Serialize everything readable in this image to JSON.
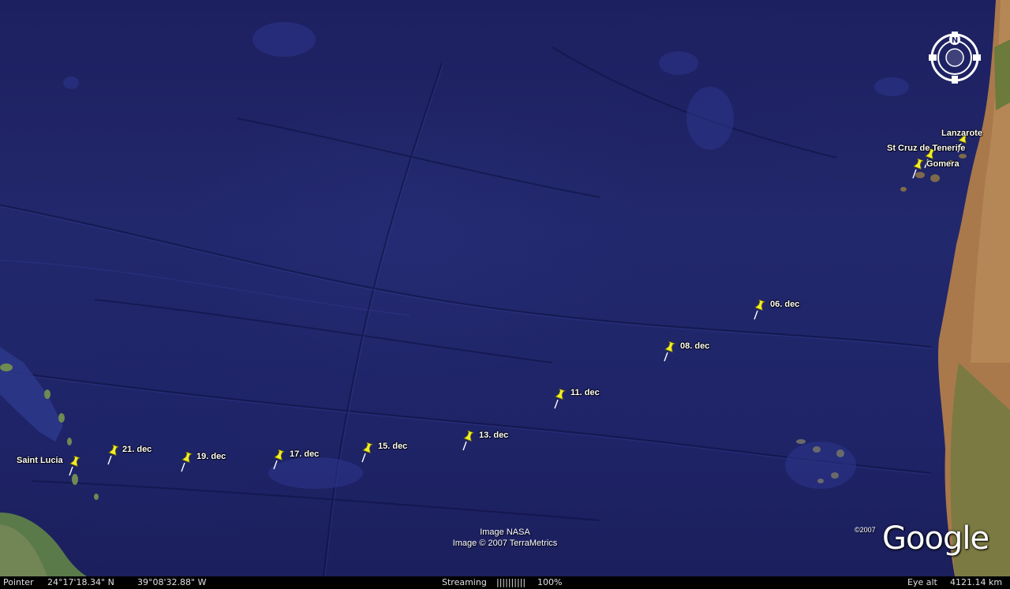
{
  "markers": [
    {
      "label": "Lanzarote"
    },
    {
      "label": "St Cruz de Tenerife"
    },
    {
      "label": "Gomera"
    },
    {
      "label": "06. dec"
    },
    {
      "label": "08. dec"
    },
    {
      "label": "11. dec"
    },
    {
      "label": "13. dec"
    },
    {
      "label": "15. dec"
    },
    {
      "label": "17. dec"
    },
    {
      "label": "19. dec"
    },
    {
      "label": "21. dec"
    },
    {
      "label": "Saint Lucia"
    }
  ],
  "compass": {
    "north_label": "N"
  },
  "credits": {
    "line1": "Image NASA",
    "line2": "Image © 2007 TerraMetrics"
  },
  "logo": {
    "copyright": "©2007",
    "text": "Google"
  },
  "statusbar": {
    "pointer_label": "Pointer",
    "latitude": "24°17'18.34\" N",
    "longitude": "39°08'32.88\" W",
    "streaming_label": "Streaming",
    "streaming_bar": "||||||||||",
    "streaming_percent": "100%",
    "eye_alt_label": "Eye alt",
    "eye_alt_value": "4121.14 km"
  },
  "colors": {
    "ocean": "#1f2468",
    "pin": "#f2ee2a",
    "land_sahara": "#b07a4a",
    "land_green": "#5d7a3c"
  }
}
